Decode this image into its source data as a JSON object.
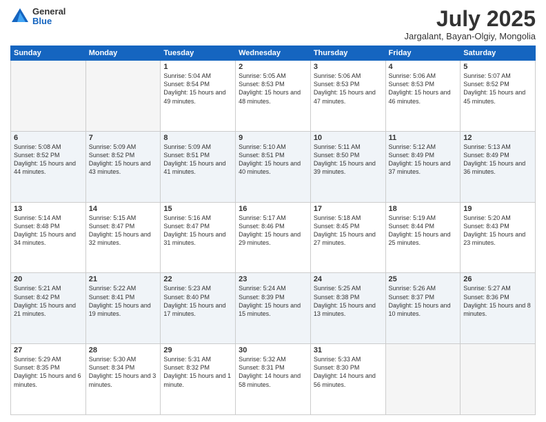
{
  "logo": {
    "general": "General",
    "blue": "Blue"
  },
  "title": "July 2025",
  "subtitle": "Jargalant, Bayan-Olgiy, Mongolia",
  "weekdays": [
    "Sunday",
    "Monday",
    "Tuesday",
    "Wednesday",
    "Thursday",
    "Friday",
    "Saturday"
  ],
  "weeks": [
    [
      {
        "day": "",
        "empty": true
      },
      {
        "day": "",
        "empty": true
      },
      {
        "day": "1",
        "sunrise": "Sunrise: 5:04 AM",
        "sunset": "Sunset: 8:54 PM",
        "daylight": "Daylight: 15 hours and 49 minutes."
      },
      {
        "day": "2",
        "sunrise": "Sunrise: 5:05 AM",
        "sunset": "Sunset: 8:53 PM",
        "daylight": "Daylight: 15 hours and 48 minutes."
      },
      {
        "day": "3",
        "sunrise": "Sunrise: 5:06 AM",
        "sunset": "Sunset: 8:53 PM",
        "daylight": "Daylight: 15 hours and 47 minutes."
      },
      {
        "day": "4",
        "sunrise": "Sunrise: 5:06 AM",
        "sunset": "Sunset: 8:53 PM",
        "daylight": "Daylight: 15 hours and 46 minutes."
      },
      {
        "day": "5",
        "sunrise": "Sunrise: 5:07 AM",
        "sunset": "Sunset: 8:52 PM",
        "daylight": "Daylight: 15 hours and 45 minutes."
      }
    ],
    [
      {
        "day": "6",
        "sunrise": "Sunrise: 5:08 AM",
        "sunset": "Sunset: 8:52 PM",
        "daylight": "Daylight: 15 hours and 44 minutes."
      },
      {
        "day": "7",
        "sunrise": "Sunrise: 5:09 AM",
        "sunset": "Sunset: 8:52 PM",
        "daylight": "Daylight: 15 hours and 43 minutes."
      },
      {
        "day": "8",
        "sunrise": "Sunrise: 5:09 AM",
        "sunset": "Sunset: 8:51 PM",
        "daylight": "Daylight: 15 hours and 41 minutes."
      },
      {
        "day": "9",
        "sunrise": "Sunrise: 5:10 AM",
        "sunset": "Sunset: 8:51 PM",
        "daylight": "Daylight: 15 hours and 40 minutes."
      },
      {
        "day": "10",
        "sunrise": "Sunrise: 5:11 AM",
        "sunset": "Sunset: 8:50 PM",
        "daylight": "Daylight: 15 hours and 39 minutes."
      },
      {
        "day": "11",
        "sunrise": "Sunrise: 5:12 AM",
        "sunset": "Sunset: 8:49 PM",
        "daylight": "Daylight: 15 hours and 37 minutes."
      },
      {
        "day": "12",
        "sunrise": "Sunrise: 5:13 AM",
        "sunset": "Sunset: 8:49 PM",
        "daylight": "Daylight: 15 hours and 36 minutes."
      }
    ],
    [
      {
        "day": "13",
        "sunrise": "Sunrise: 5:14 AM",
        "sunset": "Sunset: 8:48 PM",
        "daylight": "Daylight: 15 hours and 34 minutes."
      },
      {
        "day": "14",
        "sunrise": "Sunrise: 5:15 AM",
        "sunset": "Sunset: 8:47 PM",
        "daylight": "Daylight: 15 hours and 32 minutes."
      },
      {
        "day": "15",
        "sunrise": "Sunrise: 5:16 AM",
        "sunset": "Sunset: 8:47 PM",
        "daylight": "Daylight: 15 hours and 31 minutes."
      },
      {
        "day": "16",
        "sunrise": "Sunrise: 5:17 AM",
        "sunset": "Sunset: 8:46 PM",
        "daylight": "Daylight: 15 hours and 29 minutes."
      },
      {
        "day": "17",
        "sunrise": "Sunrise: 5:18 AM",
        "sunset": "Sunset: 8:45 PM",
        "daylight": "Daylight: 15 hours and 27 minutes."
      },
      {
        "day": "18",
        "sunrise": "Sunrise: 5:19 AM",
        "sunset": "Sunset: 8:44 PM",
        "daylight": "Daylight: 15 hours and 25 minutes."
      },
      {
        "day": "19",
        "sunrise": "Sunrise: 5:20 AM",
        "sunset": "Sunset: 8:43 PM",
        "daylight": "Daylight: 15 hours and 23 minutes."
      }
    ],
    [
      {
        "day": "20",
        "sunrise": "Sunrise: 5:21 AM",
        "sunset": "Sunset: 8:42 PM",
        "daylight": "Daylight: 15 hours and 21 minutes."
      },
      {
        "day": "21",
        "sunrise": "Sunrise: 5:22 AM",
        "sunset": "Sunset: 8:41 PM",
        "daylight": "Daylight: 15 hours and 19 minutes."
      },
      {
        "day": "22",
        "sunrise": "Sunrise: 5:23 AM",
        "sunset": "Sunset: 8:40 PM",
        "daylight": "Daylight: 15 hours and 17 minutes."
      },
      {
        "day": "23",
        "sunrise": "Sunrise: 5:24 AM",
        "sunset": "Sunset: 8:39 PM",
        "daylight": "Daylight: 15 hours and 15 minutes."
      },
      {
        "day": "24",
        "sunrise": "Sunrise: 5:25 AM",
        "sunset": "Sunset: 8:38 PM",
        "daylight": "Daylight: 15 hours and 13 minutes."
      },
      {
        "day": "25",
        "sunrise": "Sunrise: 5:26 AM",
        "sunset": "Sunset: 8:37 PM",
        "daylight": "Daylight: 15 hours and 10 minutes."
      },
      {
        "day": "26",
        "sunrise": "Sunrise: 5:27 AM",
        "sunset": "Sunset: 8:36 PM",
        "daylight": "Daylight: 15 hours and 8 minutes."
      }
    ],
    [
      {
        "day": "27",
        "sunrise": "Sunrise: 5:29 AM",
        "sunset": "Sunset: 8:35 PM",
        "daylight": "Daylight: 15 hours and 6 minutes."
      },
      {
        "day": "28",
        "sunrise": "Sunrise: 5:30 AM",
        "sunset": "Sunset: 8:34 PM",
        "daylight": "Daylight: 15 hours and 3 minutes."
      },
      {
        "day": "29",
        "sunrise": "Sunrise: 5:31 AM",
        "sunset": "Sunset: 8:32 PM",
        "daylight": "Daylight: 15 hours and 1 minute."
      },
      {
        "day": "30",
        "sunrise": "Sunrise: 5:32 AM",
        "sunset": "Sunset: 8:31 PM",
        "daylight": "Daylight: 14 hours and 58 minutes."
      },
      {
        "day": "31",
        "sunrise": "Sunrise: 5:33 AM",
        "sunset": "Sunset: 8:30 PM",
        "daylight": "Daylight: 14 hours and 56 minutes."
      },
      {
        "day": "",
        "empty": true
      },
      {
        "day": "",
        "empty": true
      }
    ]
  ]
}
